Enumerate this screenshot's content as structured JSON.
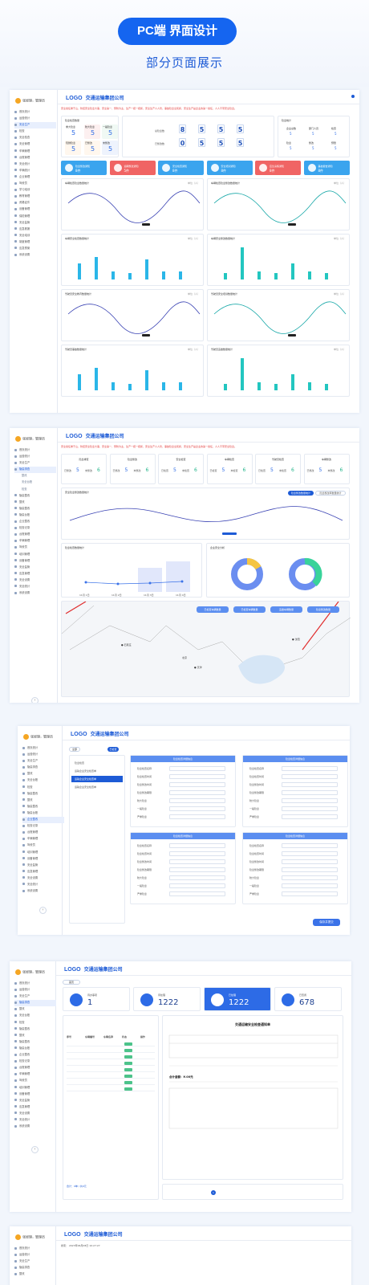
{
  "hero": {
    "title": "PC端 界面设计",
    "subtitle": "部分页面展示"
  },
  "app": {
    "logo": "LOGO",
    "company": "交通运输集团公司",
    "user": "张经理，管理员",
    "notice": "安全责任重于山，防控安全隐患大事，安全第一、预防为主，生产一把一把抓，安全生产人人管，事故隐患全民抓，安全生产是企业的第一责任，人人不带安全隐患。"
  },
  "menu": [
    "首页统计",
    "运营统计",
    "安全生产",
    "检查",
    "安全检查",
    "安全管理",
    "车辆管理",
    "台账管理",
    "安全统计",
    "车辆统计",
    "企业管理",
    "驾驶员",
    "学习培训",
    "教育管理",
    "资格证件",
    "设备管理",
    "保险管理",
    "安全监管",
    "应急救援",
    "安全培训",
    "制度管理",
    "应急预案",
    "系统设置"
  ],
  "menu2": [
    "首页统计",
    "运营统计",
    "安全生产",
    "隐患排查",
    "整改",
    "安全台账",
    "检查",
    "隐患整改",
    "整改",
    "隐患整改",
    "隐患台账",
    "企业整改",
    "检查记录",
    "台账管理",
    "车辆管理",
    "驾驶员",
    "培训管理",
    "设备管理",
    "安全监管",
    "应急管理",
    "安全设置",
    "安全统计",
    "系统设置"
  ],
  "dash": {
    "box1": {
      "title": "隐患检查数量",
      "labels": [
        "重大隐患",
        "较大隐患",
        "一般隐患",
        "轻微隐患",
        "已整改",
        "未整改"
      ],
      "values": [
        "5",
        "5",
        "5",
        "5",
        "5",
        "5"
      ]
    },
    "box2": {
      "labels": [
        "总隐患数",
        "已整改数"
      ],
      "row1": [
        "8",
        "5",
        "5",
        "5"
      ],
      "row2": [
        "0",
        "5",
        "5",
        "5"
      ]
    },
    "box3": {
      "title": "隐患统计",
      "labels": [
        "企业总数",
        "部门人员",
        "检查",
        "隐患",
        "整改",
        "预警"
      ],
      "values": [
        "5",
        "5",
        "5",
        "5",
        "5",
        "5"
      ]
    },
    "tiles": [
      {
        "label": "隐患整改通知",
        "value": "8件",
        "color": "#3aa4ee"
      },
      {
        "label": "逾期整改通知",
        "value": "5件",
        "color": "#f06464"
      },
      {
        "label": "安全检查通知",
        "value": "8件",
        "color": "#3aa4ee"
      },
      {
        "label": "安全培训通知",
        "value": "8件",
        "color": "#3aa4ee"
      },
      {
        "label": "应急演练通知",
        "value": "8件",
        "color": "#f06464"
      },
      {
        "label": "事故报告通知",
        "value": "8件",
        "color": "#3aa4ee"
      }
    ],
    "charts": [
      {
        "title": "车辆检查隐患数量统计",
        "range": "单位（人）"
      },
      {
        "title": "车辆检查隐患整改数量统计",
        "range": "单位（人）"
      },
      {
        "title": "车辆安全检查数量统计",
        "range": "单位（人）"
      },
      {
        "title": "车辆安全整改数量统计",
        "range": "单位（人）"
      },
      {
        "title": "驾驶员安全教育数量统计",
        "range": "单位（人）"
      },
      {
        "title": "驾驶员安全培训数量统计",
        "range": "单位（人）"
      },
      {
        "title": "驾驶员事故数量统计",
        "range": "单位（人）"
      },
      {
        "title": "驾驶员违章数量统计",
        "range": "单位（人）"
      }
    ]
  },
  "screen2": {
    "boxes": [
      {
        "title": "隐患排查",
        "a": "已整改",
        "b": "未整改",
        "va": "5",
        "vb": "6"
      },
      {
        "title": "隐患整改",
        "a": "已整改",
        "b": "未整改",
        "va": "5",
        "vb": "6"
      },
      {
        "title": "安全检查",
        "a": "已检查",
        "b": "未检查",
        "va": "5",
        "vb": "6"
      },
      {
        "title": "车辆检查",
        "a": "已检查",
        "b": "未检查",
        "va": "5",
        "vb": "6"
      },
      {
        "title": "驾驶员检查",
        "a": "已检查",
        "b": "未检查",
        "va": "5",
        "vb": "6"
      },
      {
        "title": "车辆整改",
        "a": "已整改",
        "b": "未整改",
        "va": "5",
        "vb": "6"
      }
    ],
    "line_title": "安全隐患整改数量统计",
    "btn1": "隐患整改数量统计",
    "btn2": "隐患整改率数量统计",
    "bar_title": "隐患检查数量统计",
    "x_labels": [
      "11月 1日",
      "11月 2日",
      "11月 3日",
      "11月 4日"
    ],
    "donut_title": "企业安全分析",
    "map_btns": [
      "已检查车辆数量",
      "已检查车辆数量",
      "违章车辆数量",
      "隐患整改数量"
    ],
    "cities": [
      "石家庄",
      "北京",
      "天津",
      "沈阳"
    ]
  },
  "screen3": {
    "btns": [
      "全部",
      "已检查",
      "已整改"
    ],
    "list": [
      "隐患检查",
      "运输企业安全检查单",
      "运输企业安全检查单",
      "运输企业安全检查单"
    ],
    "panel_title": "隐患检查详细信息",
    "fields": [
      "隐患检查名称",
      "隐患检查时间",
      "隐患整改时间",
      "隐患整改期限",
      "较大隐患",
      "一般隐患",
      "严重隐患"
    ],
    "save": "保存并提交"
  },
  "screen4": {
    "tab": "首页",
    "cards": [
      {
        "label": "待办事项",
        "value": "1"
      },
      {
        "label": "待处理",
        "value": "1222"
      },
      {
        "label": "已处理",
        "value": "1222"
      },
      {
        "label": "已查阅",
        "value": "678"
      }
    ],
    "table_cols": [
      "序号",
      "车辆编号",
      "车辆名称",
      "状态",
      "操作"
    ],
    "doc_title": "交通运输安全检查通知单",
    "doc_sub": "交通运输安全检查通知单",
    "total": "合计：0单 / 共0元",
    "fee": "合计金额：¥.00元"
  },
  "screen5": {
    "search": "搜索：",
    "date": "2023年06月08日 10:27:27"
  }
}
